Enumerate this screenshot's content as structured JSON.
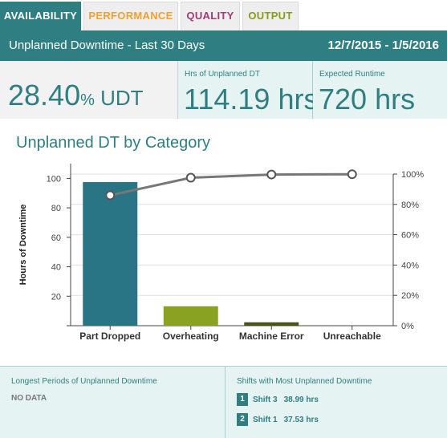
{
  "tabs": [
    {
      "label": "AVAILABILITY",
      "color": "#ffffff",
      "active": true
    },
    {
      "label": "PERFORMANCE",
      "color": "#f0a030",
      "active": false
    },
    {
      "label": "QUALITY",
      "color": "#a03a78",
      "active": false
    },
    {
      "label": "OUTPUT",
      "color": "#8a9a1a",
      "active": false
    }
  ],
  "header": {
    "title": "Unplanned Downtime - Last 30 Days",
    "date_range": "12/7/2015 - 1/5/2016"
  },
  "kpis": {
    "udt": {
      "value": "28.40",
      "unit": "%",
      "suffix": " UDT"
    },
    "unplanned_dt": {
      "label": "Hrs of Unplanned DT",
      "value": "114.19 hrs"
    },
    "expected_runtime": {
      "label": "Expected Runtime",
      "value": "720 hrs"
    }
  },
  "chart_title": "Unplanned DT by Category",
  "chart_data": {
    "type": "bar",
    "categories": [
      "Part Dropped",
      "Overheating",
      "Machine Error",
      "Unreachable"
    ],
    "series": [
      {
        "values": [
          97.5,
          13.2,
          2.3,
          0
        ],
        "colors": [
          "#2a7585",
          "#8aa222",
          "#4a5218",
          "#cccccc"
        ]
      },
      {
        "type": "line",
        "values": [
          86.0,
          97.6,
          99.7,
          99.9
        ],
        "color": "#777777"
      }
    ],
    "ylabel": "Hours of Downtime",
    "ylim": [
      0,
      110
    ],
    "y_ticks": [
      0,
      20,
      40,
      60,
      80,
      100
    ],
    "y2lim": [
      0,
      100
    ],
    "y2_ticks": [
      "0%",
      "20%",
      "40%",
      "60%",
      "80%",
      "100%"
    ],
    "grid": true
  },
  "bottom": {
    "longest": {
      "title": "Longest Periods of Unplanned Downtime",
      "empty_text": "NO DATA"
    },
    "shifts": {
      "title": "Shifts with Most Unplanned Downtime",
      "items": [
        {
          "rank": "1",
          "name": "Shift 3",
          "hours": "38.99 hrs"
        },
        {
          "rank": "2",
          "name": "Shift 1",
          "hours": "37.53 hrs"
        }
      ]
    }
  }
}
